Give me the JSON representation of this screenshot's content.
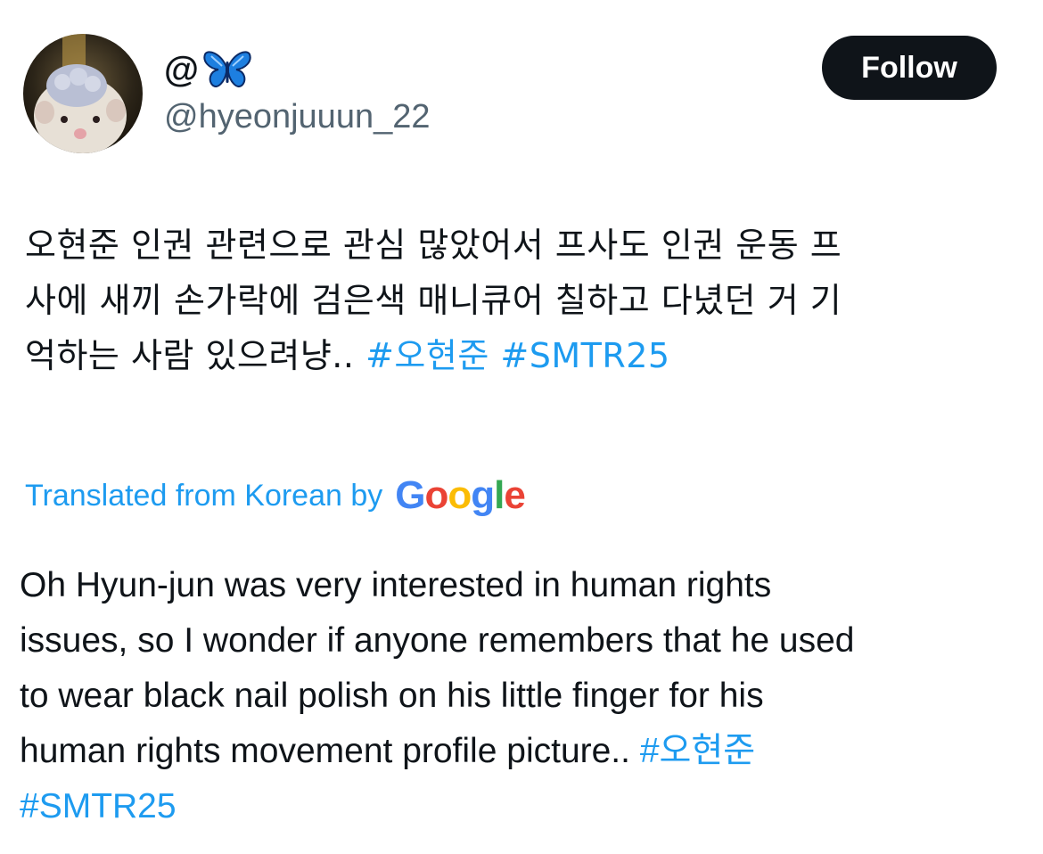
{
  "profile": {
    "display_name": "@",
    "name_icon": "blue-butterfly-icon",
    "handle": "@hyeonjuuun_22",
    "avatar_icon": "hamster-avatar"
  },
  "follow_button": {
    "label": "Follow",
    "background": "#0f1419",
    "text_color": "#ffffff"
  },
  "tweet": {
    "lines": [
      "오현준 인권 관련으로 관심 많았어서 프사도 인권 운동 프",
      "사에 새끼 손가락에 검은색 매니큐어 칠하고 다녔던 거 기",
      "억하는 사람 있으려냥.."
    ],
    "hashtags": [
      "#오현준",
      "#SMTR25"
    ]
  },
  "translation": {
    "label": "Translated from Korean by",
    "provider": {
      "letters": [
        "G",
        "o",
        "o",
        "g",
        "l",
        "e"
      ],
      "colors": [
        "#4285F4",
        "#EA4335",
        "#FBBC05",
        "#4285F4",
        "#34A853",
        "#EA4335"
      ]
    },
    "lines": [
      "Oh Hyun-jun was very interested in human rights",
      "issues, so I wonder if anyone remembers that he used",
      "to wear black nail polish on his little finger for his",
      "human rights movement profile picture.."
    ],
    "hashtags": [
      "#오현준",
      "#SMTR25"
    ]
  },
  "colors": {
    "text_primary": "#0f1419",
    "text_secondary": "#536471",
    "link": "#1d9bf0"
  }
}
